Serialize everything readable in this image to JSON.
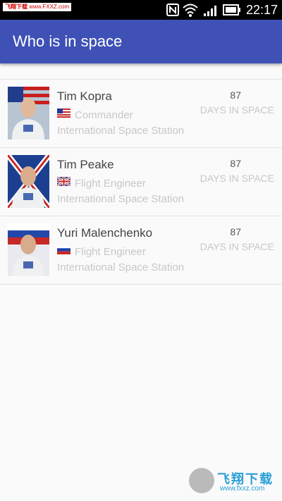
{
  "status_bar": {
    "watermark_cn": "飞翔下载",
    "watermark_url": "www.FXXZ.com",
    "time": "22:17",
    "icons": [
      "nfc-icon",
      "wifi-icon",
      "signal-icon",
      "battery-icon"
    ]
  },
  "app_bar": {
    "title": "Who is in space"
  },
  "astronauts": [
    {
      "name": "Tim Kopra",
      "role": "Commander",
      "station": "International Space Station",
      "days": "87",
      "days_label": "DAYS IN SPACE",
      "flag": "usa-flag-icon"
    },
    {
      "name": "Tim Peake",
      "role": "Flight Engineer",
      "station": "International Space Station",
      "days": "87",
      "days_label": "DAYS IN SPACE",
      "flag": "uk-flag-icon"
    },
    {
      "name": "Yuri Malenchenko",
      "role": "Flight Engineer",
      "station": "International Space Station",
      "days": "87",
      "days_label": "DAYS IN SPACE",
      "flag": "russia-flag-icon"
    }
  ],
  "watermark": {
    "cn": "飞翔下载",
    "url": "www.fxxz.com"
  },
  "colors": {
    "app_bar": "#3f51b5",
    "background": "#fafafa",
    "status_bar": "#000000"
  }
}
